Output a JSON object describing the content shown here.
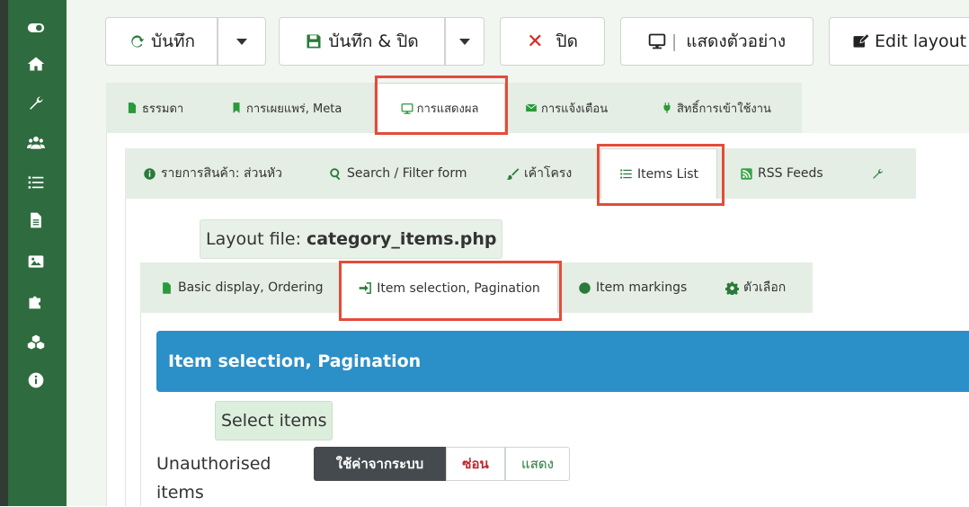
{
  "toolbar": {
    "save_label": "บันทึก",
    "save_close_label": "บันทึก & ปิด",
    "close_label": "ปิด",
    "preview_label": "แสดงตัวอย่าง",
    "edit_layout_label": "Edit layout"
  },
  "tabs_main": [
    {
      "label": "ธรรมดา",
      "icon": "file-icon"
    },
    {
      "label": "การเผยแพร่, Meta",
      "icon": "bookmark-icon"
    },
    {
      "label": "การแสดงผล",
      "icon": "desktop-icon"
    },
    {
      "label": "การแจ้งเตือน",
      "icon": "envelope-icon"
    },
    {
      "label": "สิทธิ์การเข้าใช้งาน",
      "icon": "plug-icon"
    }
  ],
  "tabs_display": [
    {
      "label": "รายการสินค้า: ส่วนหัว",
      "icon": "info-circle-icon"
    },
    {
      "label": "Search / Filter form",
      "icon": "search-icon"
    },
    {
      "label": "เค้าโครง",
      "icon": "brush-icon"
    },
    {
      "label": "Items List",
      "icon": "list-icon"
    },
    {
      "label": "RSS Feeds",
      "icon": "rss-icon"
    },
    {
      "label": "",
      "icon": "wrench-icon"
    }
  ],
  "layout_file": {
    "prefix": "Layout file:",
    "name": "category_items.php"
  },
  "tabs_items": [
    {
      "label": "Basic display, Ordering",
      "icon": "file-icon"
    },
    {
      "label": "Item selection, Pagination",
      "icon": "sign-in-icon"
    },
    {
      "label": "Item markings",
      "icon": "circle-icon"
    },
    {
      "label": "ตัวเลือก",
      "icon": "gear-icon"
    }
  ],
  "section_header": "Item selection, Pagination",
  "select_items_label": "Select items",
  "unauthorised": {
    "label": "Unauthorised items",
    "options": [
      "ใช้ค่าจากระบบ",
      "ซ่อน",
      "แสดง"
    ],
    "selected": "ใช้ค่าจากระบบ"
  },
  "colors": {
    "sidebar": "#2e6b3e",
    "accent_blue": "#2b8fc8",
    "highlight": "#e34c3a"
  },
  "sidebar_icons": [
    "toggle-icon",
    "home-icon",
    "wrench-icon",
    "users-icon",
    "list-icon",
    "file-icon",
    "image-icon",
    "puzzle-icon",
    "cubes-icon",
    "info-icon"
  ]
}
